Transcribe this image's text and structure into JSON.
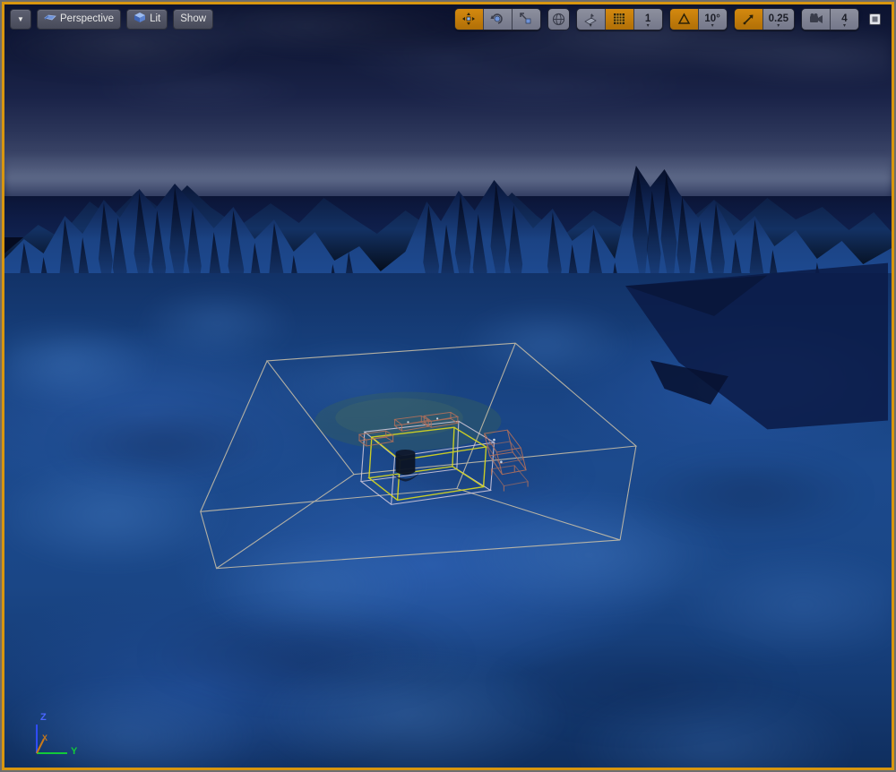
{
  "app": {
    "kind": "3d-level-editor-viewport",
    "viewport_active_border_color": "#d8960f"
  },
  "toolbar": {
    "menu_caret": "▼",
    "view_mode_label": "Perspective",
    "lighting_mode_label": "Lit",
    "show_label": "Show",
    "transform_tools": [
      {
        "name": "select-and-translate",
        "icon": "move-arrows-icon",
        "active": true
      },
      {
        "name": "rotate",
        "icon": "rotate-icon",
        "active": false
      },
      {
        "name": "scale",
        "icon": "scale-icon",
        "active": false
      }
    ],
    "coordinate_system": {
      "name": "world-coordinate-system",
      "icon": "globe-icon",
      "active": false
    },
    "surface_snap": {
      "name": "surface-snapping",
      "icon": "surface-snap-icon",
      "active": false
    },
    "grid_snap": {
      "name": "grid-snap-toggle",
      "icon": "grid-icon",
      "active": true,
      "value": "1"
    },
    "rotation_snap": {
      "name": "rotation-snap-toggle",
      "icon": "angle-icon",
      "active": true,
      "value": "10°"
    },
    "scale_snap": {
      "name": "scale-snap-toggle",
      "icon": "diagonal-arrow-icon",
      "active": true,
      "value": "0.25"
    },
    "camera_speed": {
      "name": "camera-speed",
      "icon": "camera-icon",
      "value": "4"
    },
    "maximize": {
      "name": "maximize-viewport",
      "icon": "maximize-icon"
    },
    "dropdown_caret": "▾"
  },
  "gizmo": {
    "axis_z": "Z",
    "axis_y": "Y",
    "axis_x": "X",
    "color_z": "#2f4cff",
    "color_y": "#12c93a",
    "color_x": "#c8791a"
  },
  "scene": {
    "description": "Night-time snowy mountain landscape viewport with selected wireframe volumes",
    "sky_top_color": "#0c1330",
    "sky_horizon_color": "#3d4769",
    "snow_color": "#1c4a8d",
    "water_color": "#0a1336",
    "volume_outer_color": "#cfc3a8",
    "volume_inner_color": "#d8c9d8",
    "selection_color": "#d7d71f",
    "prop_color": "#b4705a",
    "grass_patch_color": "#4a6a5c"
  }
}
